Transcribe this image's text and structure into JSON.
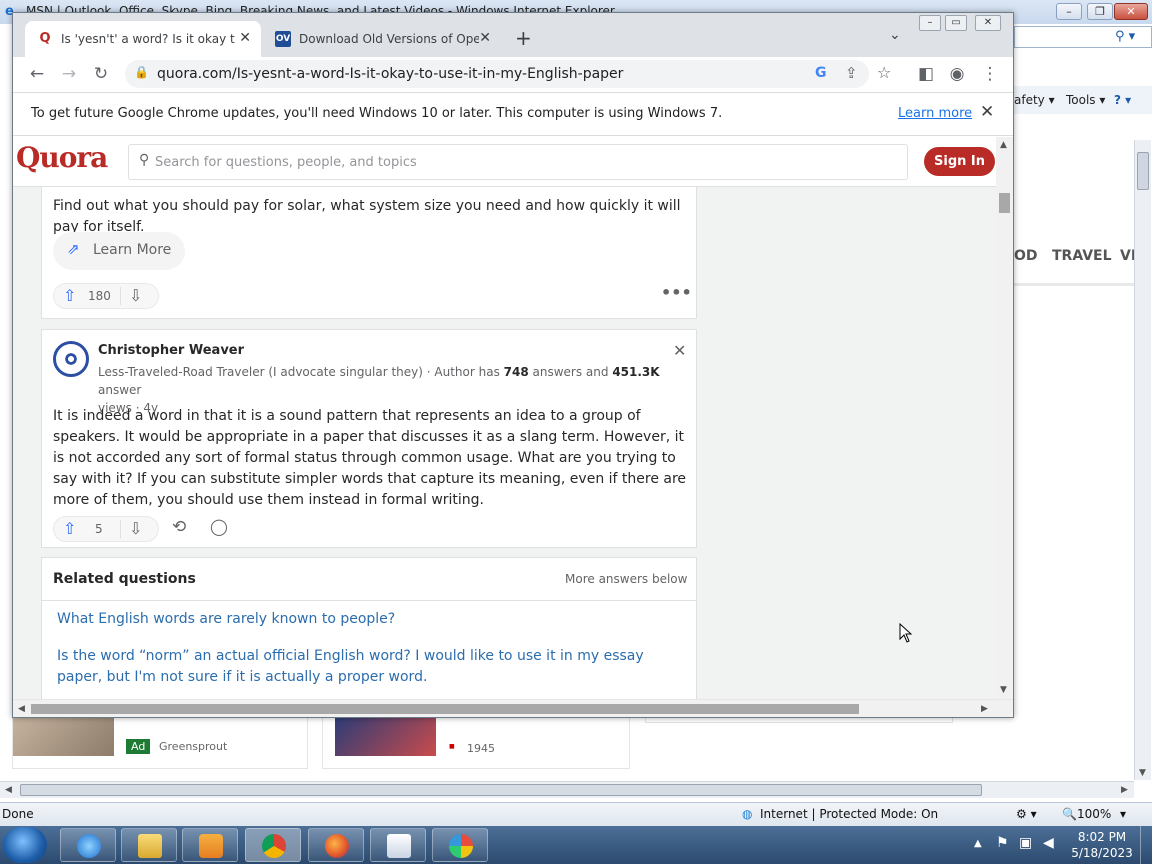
{
  "ie": {
    "title": "MSN | Outlook, Office, Skype, Bing, Breaking News, and Latest Videos - Windows Internet Explorer",
    "command_bar": {
      "safety": "afety ▾",
      "tools": "Tools ▾",
      "help_icon": "help-icon"
    },
    "msn_nav": {
      "food": "OD",
      "travel": "TRAVEL",
      "video": "VI"
    },
    "cards": [
      {
        "ad_label": "Ad",
        "source": "Greensprout"
      },
      {
        "source": "1945"
      }
    ],
    "status": {
      "left": "Done",
      "zone": "Internet | Protected Mode: On",
      "zoom": "100%"
    }
  },
  "taskbar": {
    "apps": [
      "internet-explorer",
      "file-explorer",
      "media-player",
      "chrome",
      "firefox",
      "snipping-tool",
      "paint"
    ],
    "time": "8:02 PM",
    "date": "5/18/2023"
  },
  "chrome": {
    "tabs": [
      {
        "title": "Is 'yesn't' a word? Is it okay to use it in my English paper",
        "favicon": "Q",
        "active": true
      },
      {
        "title": "Download Old Versions of Opera",
        "favicon": "OV",
        "active": false
      }
    ],
    "url": "quora.com/Is-yesnt-a-word-Is-it-okay-to-use-it-in-my-English-paper",
    "infobar": {
      "message": "To get future Google Chrome updates, you'll need Windows 10 or later. This computer is using Windows 7.",
      "link": "Learn more"
    }
  },
  "quora": {
    "logo": "Quora",
    "search_placeholder": "Search for questions, people, and topics",
    "signin": "Sign In",
    "ad": {
      "text": "Find out what you should pay for solar, what system size you need and how quickly it will pay for itself.",
      "cta": "Learn More",
      "upvotes": "180"
    },
    "answer": {
      "author": "Christopher Weaver",
      "credential_prefix": "Less-Traveled-Road Traveler (I advocate singular they) · Author has ",
      "answers_count": "748",
      "answers_mid": " answers and ",
      "views_count": "451.3K",
      "credential_suffix": " answer",
      "meta_line2": "views · 4y",
      "text": "It is indeed a word in that it is a sound pattern that represents an idea to a group of speakers. It would be appropriate in a paper that discusses it as a slang term. However, it is not accorded any sort of formal status through common usage. What are you trying to say with it? If you can substitute simpler words that capture its meaning, even if there are more of them, you should use them instead in formal writing.",
      "upvotes": "5"
    },
    "related": {
      "title": "Related questions",
      "more": "More answers below",
      "items": [
        "What English words are rarely known to people?",
        "Is the word “norm” an actual official English word? I would like to use it in my essay paper, but I'm not sure if it is actually a proper word."
      ]
    }
  }
}
